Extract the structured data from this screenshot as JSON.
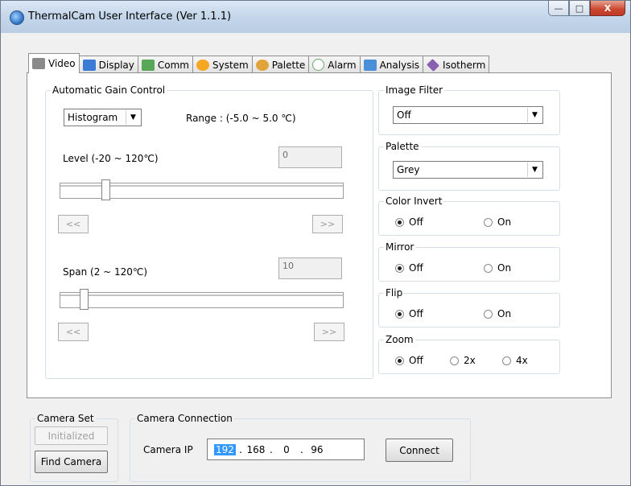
{
  "window": {
    "title": "ThermalCam User Interface (Ver 1.1.1)",
    "close_glyph": "X"
  },
  "tabs": [
    {
      "label": "Video",
      "icon": "video-icon",
      "color": "#8a8a8a"
    },
    {
      "label": "Display",
      "icon": "monitor-icon",
      "color": "#3a7bd5"
    },
    {
      "label": "Comm",
      "icon": "network-icon",
      "color": "#58a858"
    },
    {
      "label": "System",
      "icon": "gear-icon",
      "color": "#f5a623"
    },
    {
      "label": "Palette",
      "icon": "palette-icon",
      "color": "#e2a43a"
    },
    {
      "label": "Alarm",
      "icon": "clock-icon",
      "color": "#6aa86a"
    },
    {
      "label": "Analysis",
      "icon": "chart-icon",
      "color": "#4a90d9"
    },
    {
      "label": "Isotherm",
      "icon": "diamond-icon",
      "color": "#8a5fb0"
    }
  ],
  "agc": {
    "legend": "Automatic Gain Control",
    "mode": "Histogram",
    "range_text": "Range : (-5.0 ~ 5.0 ℃)",
    "level_label": "Level (-20 ~ 120℃)",
    "level_value": "0",
    "level_fraction": 0.15,
    "span_label": "Span (2 ~ 120℃)",
    "span_value": "10",
    "span_fraction": 0.07,
    "prev": "<<",
    "next": ">>"
  },
  "image_filter": {
    "legend": "Image Filter",
    "value": "Off"
  },
  "palette": {
    "legend": "Palette",
    "value": "Grey"
  },
  "color_invert": {
    "legend": "Color Invert",
    "off": "Off",
    "on": "On",
    "selected": "off"
  },
  "mirror": {
    "legend": "Mirror",
    "off": "Off",
    "on": "On",
    "selected": "off"
  },
  "flip": {
    "legend": "Flip",
    "off": "Off",
    "on": "On",
    "selected": "off"
  },
  "zoom": {
    "legend": "Zoom",
    "off": "Off",
    "x2": "2x",
    "x4": "4x",
    "selected": "off"
  },
  "camera_set": {
    "legend": "Camera Set",
    "initialized": "Initialized",
    "find": "Find Camera"
  },
  "camera_connection": {
    "legend": "Camera Connection",
    "ip_label": "Camera IP",
    "ip": [
      "192",
      "168",
      "0",
      "96"
    ],
    "dot": ".",
    "connect": "Connect"
  }
}
